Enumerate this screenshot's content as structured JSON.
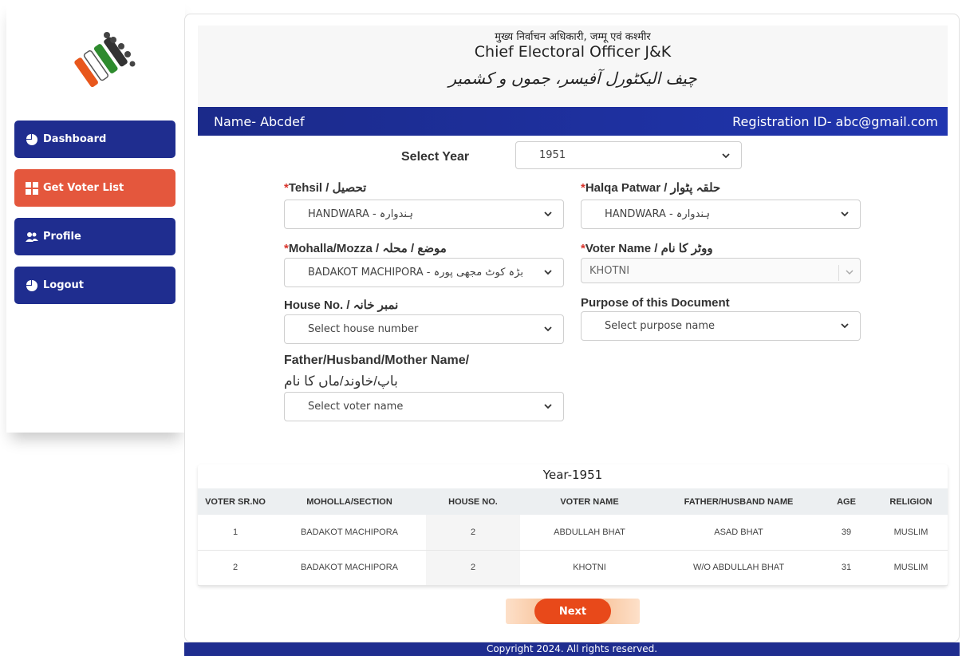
{
  "sidebar": {
    "items": [
      {
        "label": "Dashboard",
        "icon": "pie-chart-icon"
      },
      {
        "label": "Get Voter List",
        "icon": "grid-icon"
      },
      {
        "label": "Profile",
        "icon": "users-icon"
      },
      {
        "label": "Logout",
        "icon": "pie-chart-icon"
      }
    ]
  },
  "banner": {
    "hindi": "मुख्य निर्वाचन अधिकारी, जम्मू एवं कश्मीर",
    "english": "Chief Electoral Officer J&K",
    "urdu": "چیف الیکٹورل آفیسر، جموں و کشمیر"
  },
  "userbar": {
    "name": "Name- Abcdef",
    "registration": "Registration ID- abc@gmail.com"
  },
  "form": {
    "year_label": "Select Year",
    "year_value": "1951",
    "tehsil_label": "Tehsil / تحصیل",
    "tehsil_value": "HANDWARA - ہندوارہ",
    "halqa_label": "Halqa Patwar / حلقہ پٹوار",
    "halqa_value": "HANDWARA - ہندوارہ",
    "mohalla_label": "Mohalla/Mozza / موضع / محلہ",
    "mohalla_value": "BADAKOT MACHIPORA - بڑہ کوٹ مجھی پورہ",
    "voter_label": "Voter Name / ووٹر کا نام",
    "voter_value": "KHOTNI",
    "house_label": "House No. / نمبر خانہ",
    "house_placeholder": "Select house number",
    "purpose_label": "Purpose of this Document",
    "purpose_placeholder": "Select purpose name",
    "father_label_line1": "Father/Husband/Mother Name/",
    "father_label_line2": "باپ/خاوند/ماں کا نام",
    "father_placeholder": "Select voter name",
    "required_mark": "*"
  },
  "table": {
    "title": "Year-1951",
    "headers": [
      "VOTER SR.NO",
      "MOHOLLA/SECTION",
      "HOUSE NO.",
      "VOTER NAME",
      "FATHER/HUSBAND NAME",
      "AGE",
      "RELIGION"
    ],
    "rows": [
      [
        "1",
        "BADAKOT MACHIPORA",
        "2",
        "ABDULLAH BHAT",
        "ASAD BHAT",
        "39",
        "MUSLIM"
      ],
      [
        "2",
        "BADAKOT MACHIPORA",
        "2",
        "KHOTNI",
        "W/O ABDULLAH BHAT",
        "31",
        "MUSLIM"
      ]
    ]
  },
  "next_label": "Next",
  "footer": "Copyright 2024. All rights reserved.",
  "colors": {
    "nav_blue": "#1f2d8f",
    "nav_orange": "#e4573d",
    "next_orange": "#e8491a",
    "required_red": "#d9342b"
  }
}
